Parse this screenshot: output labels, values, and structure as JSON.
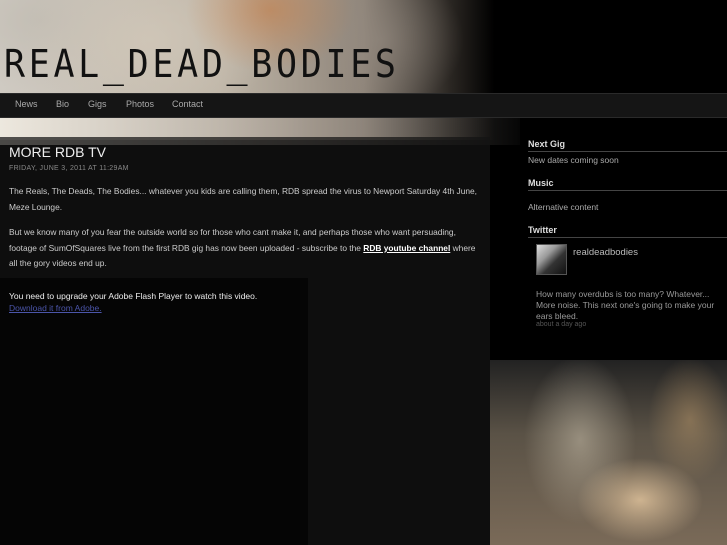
{
  "site": {
    "title": "REAL_DEAD_BODIES"
  },
  "nav": {
    "items": [
      "News",
      "Bio",
      "Gigs",
      "Photos",
      "Contact"
    ]
  },
  "post": {
    "title": "MORE RDB TV",
    "date": "FRIDAY, JUNE 3, 2011 AT 11:29AM",
    "p1": "The Reals, The Deads, The Bodies... whatever you kids are calling them, RDB spread the virus to Newport Saturday 4th June, Meze Lounge.",
    "p2_text": "But we know many of you fear the outside world so for those who cant make it, and perhaps those who want persuading, footage of SumOfSquares live from the first RDB gig has now been uploaded - subscribe to the ",
    "p2_link": "RDB youtube channel",
    "p2_tail": " where all the gory videos end up.",
    "flash_message": "You need to upgrade your Adobe Flash Player to watch this video.",
    "flash_link": "Download it from Adobe."
  },
  "sidebar": {
    "next_gig": {
      "heading": "Next Gig",
      "text": "New dates coming soon"
    },
    "music": {
      "heading": "Music",
      "text": "Alternative content"
    },
    "twitter": {
      "heading": "Twitter",
      "username": "realdeadbodies",
      "tweet": "How many overdubs is too many? Whatever... More noise. This next one's going to make your ears bleed.",
      "time": "about a day ago"
    }
  }
}
